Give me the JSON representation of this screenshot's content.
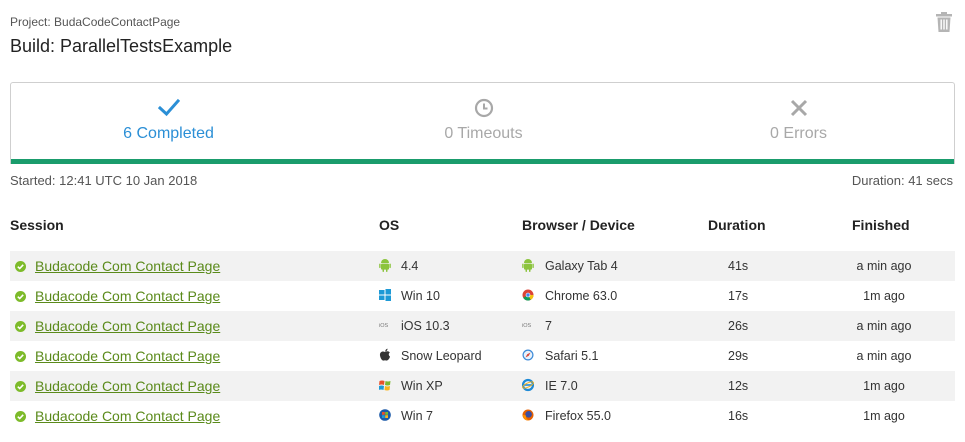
{
  "header": {
    "project": "Project: BudaCodeContactPage",
    "build": "Build: ParallelTestsExample"
  },
  "summary": {
    "completed": "6 Completed",
    "timeouts": "0 Timeouts",
    "errors": "0 Errors",
    "started": "Started: 12:41 UTC 10 Jan 2018",
    "duration": "Duration: 41 secs"
  },
  "columns": {
    "session": "Session",
    "os": "OS",
    "browser": "Browser / Device",
    "duration": "Duration",
    "finished": "Finished"
  },
  "colors": {
    "accent_bar": "#1a9c6c",
    "completed_blue": "#2b8fd6",
    "link_green": "#5a8a1a",
    "status_green": "#7dbb2a"
  },
  "rows": [
    {
      "session": "Budacode Com Contact Page",
      "os_icon": "android-icon",
      "os": "4.4",
      "browser_icon": "android-icon",
      "browser": "Galaxy Tab 4",
      "duration": "41s",
      "finished": "a min ago"
    },
    {
      "session": "Budacode Com Contact Page",
      "os_icon": "windows-icon",
      "os": "Win 10",
      "browser_icon": "chrome-icon",
      "browser": "Chrome 63.0",
      "duration": "17s",
      "finished": "1m ago"
    },
    {
      "session": "Budacode Com Contact Page",
      "os_icon": "ios-icon",
      "os": "iOS 10.3",
      "browser_icon": "ios-icon",
      "browser": "7",
      "duration": "26s",
      "finished": "a min ago"
    },
    {
      "session": "Budacode Com Contact Page",
      "os_icon": "apple-icon",
      "os": "Snow Leopard",
      "browser_icon": "safari-icon",
      "browser": "Safari 5.1",
      "duration": "29s",
      "finished": "a min ago"
    },
    {
      "session": "Budacode Com Contact Page",
      "os_icon": "windows-xp-icon",
      "os": "Win XP",
      "browser_icon": "ie-icon",
      "browser": "IE 7.0",
      "duration": "12s",
      "finished": "1m ago"
    },
    {
      "session": "Budacode Com Contact Page",
      "os_icon": "windows-7-icon",
      "os": "Win 7",
      "browser_icon": "firefox-icon",
      "browser": "Firefox 55.0",
      "duration": "16s",
      "finished": "1m ago"
    }
  ]
}
